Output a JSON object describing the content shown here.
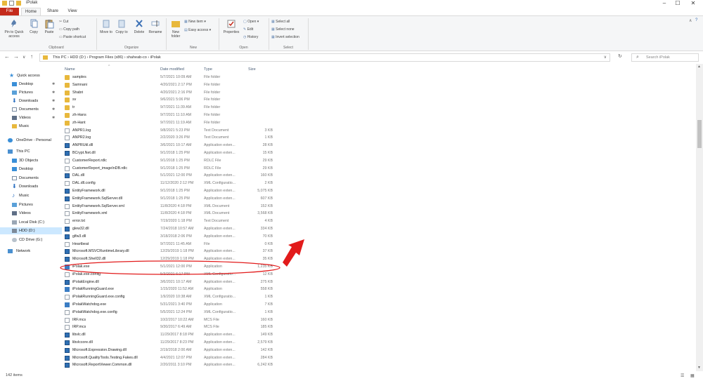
{
  "window": {
    "title": "iPolak",
    "minimize": "–",
    "maximize": "☐",
    "close": "✕"
  },
  "tabs": [
    {
      "label": "File"
    },
    {
      "label": "Home"
    },
    {
      "label": "Share"
    },
    {
      "label": "View"
    }
  ],
  "ribbon": {
    "clipboard": {
      "pin_label": "Pin to Quick access",
      "copy_label": "Copy",
      "paste_label": "Paste",
      "cut_label": "Cut",
      "copy_path_label": "Copy path",
      "paste_shortcut_label": "Paste shortcut",
      "group_label": "Clipboard"
    },
    "organize": {
      "move_label": "Move to",
      "copy_to_label": "Copy to",
      "delete_label": "Delete",
      "rename_label": "Rename",
      "group_label": "Organize"
    },
    "new": {
      "new_folder_label": "New folder",
      "new_item_label": "New item",
      "easy_access_label": "Easy access",
      "group_label": "New"
    },
    "open": {
      "properties_label": "Properties",
      "open_label": "Open",
      "edit_label": "Edit",
      "history_label": "History",
      "group_label": "Open"
    },
    "select": {
      "select_all_label": "Select all",
      "select_none_label": "Select none",
      "invert_label": "Invert selection",
      "group_label": "Select"
    }
  },
  "address": {
    "crumbs": "This PC  ›  HDD (D:)  ›  Program Files (x86)  ›  shaheab-co  ›  iPolak",
    "search_placeholder": "Search iPolak"
  },
  "nav": {
    "quick_access": "Quick access",
    "items": [
      {
        "label": "Desktop"
      },
      {
        "label": "Pictures"
      },
      {
        "label": "Downloads"
      },
      {
        "label": "Documents"
      },
      {
        "label": "Videos"
      },
      {
        "label": "Music"
      }
    ],
    "onedrive": "OneDrive - Personal",
    "this_pc": "This PC",
    "pc_items": [
      {
        "label": "3D Objects"
      },
      {
        "label": "Desktop"
      },
      {
        "label": "Documents"
      },
      {
        "label": "Downloads"
      },
      {
        "label": "Music"
      },
      {
        "label": "Pictures"
      },
      {
        "label": "Videos"
      },
      {
        "label": "Local Disk (C:)"
      },
      {
        "label": "HDD (D:)"
      },
      {
        "label": "CD Drive (G:)"
      }
    ],
    "network": "Network"
  },
  "columns": {
    "name": "Name",
    "date": "Date modified",
    "type": "Type",
    "size": "Size"
  },
  "files": [
    {
      "name": "samples",
      "date": "5/7/2021 10:09 AM",
      "type": "File folder",
      "size": "",
      "kind": "folder"
    },
    {
      "name": "Samnani",
      "date": "4/20/2021 2:17 PM",
      "type": "File folder",
      "size": "",
      "kind": "folder"
    },
    {
      "name": "Shabri",
      "date": "4/20/2021 2:16 PM",
      "type": "File folder",
      "size": "",
      "kind": "folder"
    },
    {
      "name": "sv",
      "date": "9/6/2021 5:06 PM",
      "type": "File folder",
      "size": "",
      "kind": "folder"
    },
    {
      "name": "tr",
      "date": "9/7/2021 11:39 AM",
      "type": "File folder",
      "size": "",
      "kind": "folder"
    },
    {
      "name": "zh-Hans",
      "date": "9/7/2021 11:10 AM",
      "type": "File folder",
      "size": "",
      "kind": "folder"
    },
    {
      "name": "zh-Hant",
      "date": "9/7/2021 11:19 AM",
      "type": "File folder",
      "size": "",
      "kind": "folder"
    },
    {
      "name": "ANPR1.log",
      "date": "9/8/2021 5:23 PM",
      "type": "Text Document",
      "size": "3 KB",
      "kind": "doc"
    },
    {
      "name": "ANPR2.log",
      "date": "2/2/2020 3:26 PM",
      "type": "Text Document",
      "size": "1 KB",
      "kind": "doc"
    },
    {
      "name": "ANPRUtil.dll",
      "date": "3/6/2021 10:17 AM",
      "type": "Application exten...",
      "size": "28 KB",
      "kind": "app"
    },
    {
      "name": "BCrypt.Net.dll",
      "date": "9/1/2018 1:25 PM",
      "type": "Application exten...",
      "size": "15 KB",
      "kind": "app"
    },
    {
      "name": "CustomerReport.rdlc",
      "date": "9/1/2018 1:25 PM",
      "type": "RDLC File",
      "size": "29 KB",
      "kind": "doc"
    },
    {
      "name": "CustomerReport_imageInDB.rdlc",
      "date": "9/1/2018 1:25 PM",
      "type": "RDLC File",
      "size": "29 KB",
      "kind": "doc"
    },
    {
      "name": "DAL.dll",
      "date": "5/1/2021 12:00 PM",
      "type": "Application exten...",
      "size": "160 KB",
      "kind": "app"
    },
    {
      "name": "DAL.dll.config",
      "date": "11/12/2020 2:12 PM",
      "type": "XML Configuratio...",
      "size": "2 KB",
      "kind": "doc"
    },
    {
      "name": "EntityFramework.dll",
      "date": "9/1/2018 1:25 PM",
      "type": "Application exten...",
      "size": "5,075 KB",
      "kind": "app"
    },
    {
      "name": "EntityFramework.SqlServer.dll",
      "date": "9/1/2018 1:25 PM",
      "type": "Application exten...",
      "size": "607 KB",
      "kind": "app"
    },
    {
      "name": "EntityFramework.SqlServer.xml",
      "date": "11/8/2020 4:18 PM",
      "type": "XML Document",
      "size": "152 KB",
      "kind": "doc"
    },
    {
      "name": "EntityFramework.xml",
      "date": "11/8/2020 4:18 PM",
      "type": "XML Document",
      "size": "3,568 KB",
      "kind": "doc"
    },
    {
      "name": "error.txt",
      "date": "7/19/2020 1:18 PM",
      "type": "Text Document",
      "size": "4 KB",
      "kind": "doc"
    },
    {
      "name": "glew32.dll",
      "date": "7/24/2018 10:57 AM",
      "type": "Application exten...",
      "size": "334 KB",
      "kind": "app"
    },
    {
      "name": "glfw3.dll",
      "date": "3/18/2018 2:06 PM",
      "type": "Application exten...",
      "size": "70 KB",
      "kind": "app"
    },
    {
      "name": "Heartbeat",
      "date": "9/7/2021 11:45 AM",
      "type": "File",
      "size": "0 KB",
      "kind": "doc"
    },
    {
      "name": "Microsoft.MSVCRuntimeLibrary.dll",
      "date": "12/29/2019 1:18 PM",
      "type": "Application exten...",
      "size": "37 KB",
      "kind": "app"
    },
    {
      "name": "Microsoft.Shell32.dll",
      "date": "12/29/2019 1:18 PM",
      "type": "Application exten...",
      "size": "35 KB",
      "kind": "app"
    },
    {
      "name": "iPolak.exe",
      "date": "5/1/2021 12:00 PM",
      "type": "Application",
      "size": "1,235 KB",
      "kind": "exe"
    },
    {
      "name": "iPolak.exe.config",
      "date": "5/3/2021 6:17 PM",
      "type": "XML Configuratio...",
      "size": "12 KB",
      "kind": "doc"
    },
    {
      "name": "iPolakEngine.dll",
      "date": "3/6/2021 10:17 AM",
      "type": "Application exten...",
      "size": "275 KB",
      "kind": "app"
    },
    {
      "name": "iPolakRunningGuard.exe",
      "date": "1/15/2020 11:52 AM",
      "type": "Application",
      "size": "558 KB",
      "kind": "exe"
    },
    {
      "name": "iPolakRunningGuard.exe.config",
      "date": "1/9/2020 10:38 AM",
      "type": "XML Configuratio...",
      "size": "1 KB",
      "kind": "doc"
    },
    {
      "name": "iPolakWatchdog.exe",
      "date": "5/31/2021 3:40 PM",
      "type": "Application",
      "size": "7 KB",
      "kind": "exe"
    },
    {
      "name": "iPolakWatchdog.exe.config",
      "date": "5/5/2021 12:24 PM",
      "type": "XML Configuratio...",
      "size": "1 KB",
      "kind": "doc"
    },
    {
      "name": "IRF.mcs",
      "date": "10/2/2017 10:22 AM",
      "type": "MCS File",
      "size": "160 KB",
      "kind": "doc"
    },
    {
      "name": "IRP.mcs",
      "date": "9/30/2017 6:49 AM",
      "type": "MCS File",
      "size": "185 KB",
      "kind": "doc"
    },
    {
      "name": "libvlc.dll",
      "date": "11/29/2017 8:18 PM",
      "type": "Application exten...",
      "size": "149 KB",
      "kind": "app"
    },
    {
      "name": "libvlccore.dll",
      "date": "11/29/2017 8:23 PM",
      "type": "Application exten...",
      "size": "2,579 KB",
      "kind": "app"
    },
    {
      "name": "Microsoft.Expression.Drawing.dll",
      "date": "2/19/2018 2:00 AM",
      "type": "Application exten...",
      "size": "142 KB",
      "kind": "app"
    },
    {
      "name": "Microsoft.QualityTools.Testing.Fakes.dll",
      "date": "4/4/2021 12:07 PM",
      "type": "Application exten...",
      "size": "284 KB",
      "kind": "app"
    },
    {
      "name": "Microsoft.ReportViewer.Common.dll",
      "date": "2/20/2011 3:10 PM",
      "type": "Application exten...",
      "size": "6,242 KB",
      "kind": "app"
    }
  ],
  "status": {
    "items": "142 items"
  },
  "colors": {
    "file_tab": "#c42b1c",
    "annotation": "#e21b1b",
    "selection": "#cce8ff"
  }
}
